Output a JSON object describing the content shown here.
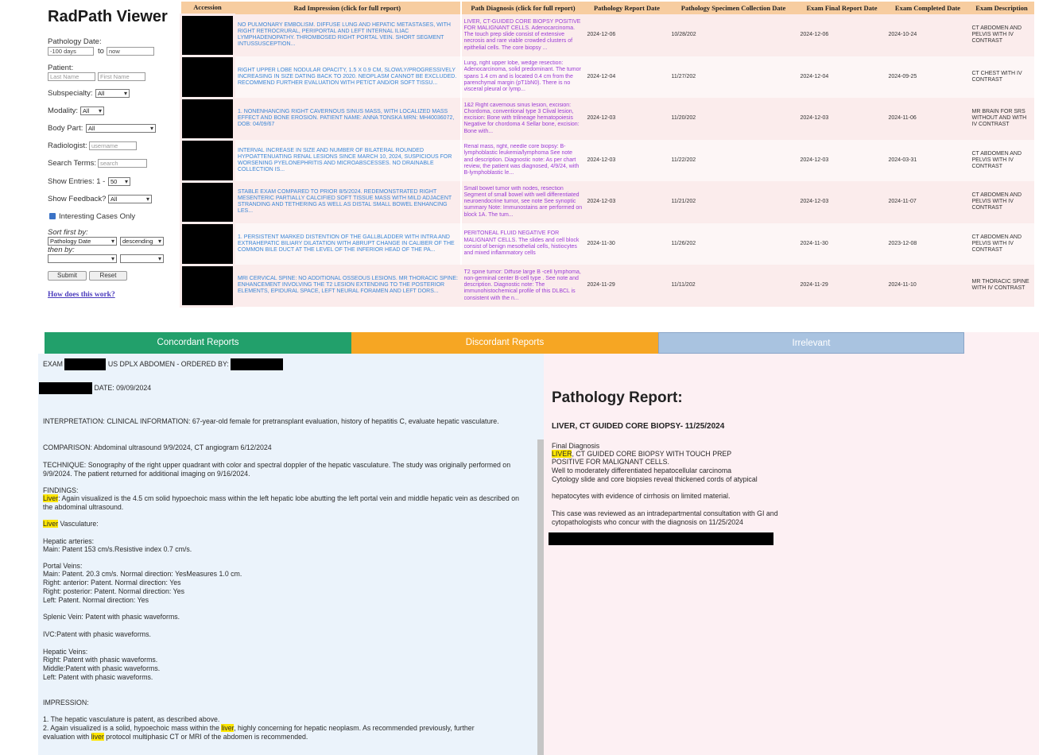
{
  "app": {
    "title": "RadPath Viewer"
  },
  "filters": {
    "pathology_date_label": "Pathology Date:",
    "date_from": "-100 days",
    "date_to_label": "to",
    "date_to": "now",
    "patient_label": "Patient:",
    "last_name_placeholder": "Last Name",
    "first_name_placeholder": "First Name",
    "subspecialty_label": "Subspecialty:",
    "subspecialty_value": "All",
    "modality_label": "Modality:",
    "modality_value": "All",
    "body_part_label": "Body Part:",
    "body_part_value": "All",
    "radiologist_label": "Radiologist:",
    "radiologist_placeholder": "username",
    "search_label": "Search Terms:",
    "search_placeholder": "search",
    "show_entries_label": "Show Entries: 1 -",
    "show_entries_value": "50",
    "show_feedback_label": "Show Feedback?",
    "show_feedback_value": "All",
    "interesting_label": "Interesting Cases Only",
    "sort_first_label": "Sort first by:",
    "sort_first_value": "Pathology Date",
    "sort_order_value": "descending",
    "then_by_label": "then by:",
    "submit_label": "Submit",
    "reset_label": "Reset",
    "how_link": "How does this work?"
  },
  "table": {
    "headers": [
      "Accession",
      "Rad Impression (click for full report)",
      "Path Diagnosis (click for full report)",
      "Pathology Report Date",
      "Pathology Specimen Collection Date",
      "Exam Final Report Date",
      "Exam Completed Date",
      "Exam Description"
    ],
    "rows": [
      {
        "rad": "NO PULMONARY EMBOLISM. DIFFUSE LUNG AND HEPATIC METASTASES, WITH RIGHT RETROCRURAL, PERIPORTAL AND LEFT INTERNAL ILIAC LYMPHADENOPATHY. THROMBOSED RIGHT PORTAL VEIN. SHORT SEGMENT INTUSSUSCEPTION...",
        "path": "LIVER, CT-GUIDED CORE BIOPSY POSITIVE FOR MALIGNANT CELLS. Adenocarcinoma. The touch prep slide consist of extensive necrosis and rare viable crowded clusters of epithelial cells. The core biopsy ...",
        "prd": "2024-12-06",
        "psc": "10/28/202",
        "efr": "2024-12-06",
        "ecd": "2024-10-24",
        "desc": "CT ABDOMEN AND PELVIS WITH IV CONTRAST"
      },
      {
        "rad": "RIGHT UPPER LOBE NODULAR OPACITY, 1.5 X 0.9 CM, SLOWLY/PROGRESSIVELY INCREASING IN SIZE DATING BACK TO 2020. NEOPLASM CANNOT BE EXCLUDED. RECOMMEND FURTHER EVALUATION WITH PET/CT AND/OR SOFT TISSU...",
        "path": "Lung, right upper lobe, wedge resection: Adenocarcinoma, solid predominant. The tumor spans 1.4 cm and is located 0.4 cm from the parenchymal margin (pT1bN0). There is no visceral pleural or lymp...",
        "prd": "2024-12-04",
        "psc": "11/27/202",
        "efr": "2024-12-04",
        "ecd": "2024-09-25",
        "desc": "CT CHEST WITH IV CONTRAST"
      },
      {
        "rad": "1. NONENHANCING RIGHT CAVERNOUS SINUS MASS, WITH LOCALIZED MASS EFFECT AND BONE EROSION. PATIENT NAME: ANNA TONSKA MRN: MH40036072, DOB: 04/09/67",
        "path": "1&2 Right cavernous sinus lesion, excision: Chordoma, conventional type 3 Clival lesion, excision: Bone with trilineage hematopoiesis Negative for chordoma 4 Sellar bone, excision: Bone with...",
        "prd": "2024-12-03",
        "psc": "11/20/202",
        "efr": "2024-12-03",
        "ecd": "2024-11-06",
        "desc": "MR BRAIN FOR SRS WITHOUT AND WITH IV CONTRAST"
      },
      {
        "rad": "INTERVAL INCREASE IN SIZE AND NUMBER OF BILATERAL ROUNDED HYPOATTENUATING RENAL LESIONS SINCE MARCH 10, 2024, SUSPICIOUS FOR WORSENING PYELONEPHRITIS AND MICROABSCESSES. NO DRAINABLE COLLECTION IS...",
        "path": "Renal mass, right, needle core biopsy: B-lymphoblastic leukemia/lymphoma See note and description. Diagnostic note: As per chart review, the patient was diagnosed, 4/9/24, with B-lymphoblastic le...",
        "prd": "2024-12-03",
        "psc": "11/22/202",
        "efr": "2024-12-03",
        "ecd": "2024-03-31",
        "desc": "CT ABDOMEN AND PELVIS WITH IV CONTRAST"
      },
      {
        "rad": "STABLE EXAM COMPARED TO PRIOR 8/5/2024. REDEMONSTRATED RIGHT MESENTERIC PARTIALLY CALCIFIED SOFT TISSUE MASS WITH MILD ADJACENT STRANDING AND TETHERING AS WELL AS DISTAL SMALL BOWEL ENHANCING LES...",
        "path": "Small bowel tumor with nodes, resection Segment of small bowel with well differentiated neuroendocrine tumor, see note See synoptic summary Note: Immunostains are performed on block 1A. The tum...",
        "prd": "2024-12-03",
        "psc": "11/21/202",
        "efr": "2024-12-03",
        "ecd": "2024-11-07",
        "desc": "CT ABDOMEN AND PELVIS WITH IV CONTRAST"
      },
      {
        "rad": "1. PERSISTENT MARKED DISTENTION OF THE GALLBLADDER WITH INTRA AND EXTRAHEPATIC BILIARY DILATATION WITH ABRUPT CHANGE IN CALIBER OF THE COMMON BILE DUCT AT THE LEVEL OF THE INFERIOR HEAD OF THE PA...",
        "path": "PERITONEAL FLUID NEGATIVE FOR MALIGNANT CELLS. The slides and cell block consist of benign mesothelial cells, histiocytes and mixed inflammatory cells",
        "prd": "2024-11-30",
        "psc": "11/26/202",
        "efr": "2024-11-30",
        "ecd": "2023-12-08",
        "desc": "CT ABDOMEN AND PELVIS WITH IV CONTRAST"
      },
      {
        "rad": "MRI CERVICAL SPINE: NO ADDITIONAL OSSEOUS LESIONS. MR THORACIC SPINE: ENHANCEMENT INVOLVING THE T2 LESION EXTENDING TO THE POSTERIOR ELEMENTS, EPIDURAL SPACE, LEFT NEURAL FORAMEN AND LEFT DORS...",
        "path": "T2 spine tumor: Diffuse large B -cell lymphoma, non-germinal center B-cell type . See note and description. Diagnostic note: The immunohistochemical profile of this DLBCL is consistent with the n...",
        "prd": "2024-11-29",
        "psc": "11/11/202",
        "efr": "2024-11-29",
        "ecd": "2024-11-10",
        "desc": "MR THORACIC SPINE WITH IV CONTRAST"
      }
    ]
  },
  "tabs": {
    "concordant": "Concordant Reports",
    "discordant": "Discordant Reports",
    "irrelevant": "Irrelevant"
  },
  "colors": {
    "concordant": "#22a06b",
    "discordant": "#f6a623",
    "irrelevant": "#a9c3e0",
    "header": "#f7cda0",
    "rad_text": "#3a86d6",
    "path_text": "#9b3bd6",
    "highlight": "#ffe600"
  },
  "radreport": {
    "exam_label": "EXAM",
    "exam_title": "US DPLX ABDOMEN - ORDERED BY:",
    "date": "DATE: 09/09/2024",
    "interpretation": "INTERPRETATION: CLINICAL INFORMATION: 67-year-old female for pretransplant evaluation, history of hepatitis C, evaluate hepatic vasculature.",
    "comparison": "COMPARISON: Abdominal ultrasound 9/9/2024, CT angiogram 6/12/2024",
    "technique": "TECHNIQUE: Sonography of the right upper quadrant with color and spectral doppler of the hepatic vasculature. The study was originally performed on 9/9/2024. The patient returned for additional imaging on 9/16/2024.",
    "findings_label": "FINDINGS:",
    "liver_word": "Liver",
    "findings_text": ": Again visualized is the 4.5 cm solid hypoechoic mass within the left hepatic lobe abutting the left portal vein and middle hepatic vein as described on the abdominal ultrasound.",
    "vasculature": " Vasculature:",
    "hepatic_arteries": "Hepatic arteries:",
    "main_artery": "Main: Patent 153 cm/s.Resistive index 0.7 cm/s.",
    "portal_veins": "Portal Veins:",
    "pv_main": "Main: Patent. 20.3 cm/s. Normal direction: YesMeasures 1.0 cm.",
    "pv_right_anterior": "Right: anterior: Patent. Normal direction: Yes",
    "pv_right_posterior": "Right: posterior: Patent. Normal direction: Yes",
    "pv_left": "Left: Patent. Normal direction: Yes",
    "splenic": "Splenic Vein: Patent with phasic waveforms.",
    "ivc": "IVC:Patent with phasic waveforms.",
    "hepatic_veins": "Hepatic Veins:",
    "hv_right": "Right: Patent with phasic waveforms.",
    "hv_middle": "Middle:Patent with phasic waveforms.",
    "hv_left": "Left: Patent with phasic waveforms.",
    "impression_label": "IMPRESSION:",
    "imp1": "1. The hepatic vasculature is patent, as described above.",
    "imp2a": "2. Again visualized is a solid, hypoechoic mass within the",
    "imp2_liver": "liver",
    "imp2b": ", highly concerning for hepatic neoplasm. As recommended previously, further",
    "imp3a": "evaluation with",
    "imp3_liver": "liver",
    "imp3b": "protocol multiphasic CT or MRI of the abdomen is recommended."
  },
  "pathreport": {
    "title": "Pathology Report:",
    "subtitle": "LIVER, CT GUIDED CORE BIOPSY- 11/25/2024",
    "final_dx": "Final Diagnosis",
    "liver_word": "LIVER",
    "line1": ", CT GUIDED CORE BIOPSY WITH TOUCH PREP",
    "line2": "POSITIVE FOR MALIGNANT CELLS.",
    "line3": "Well to moderately differentiated hepatocellular carcinoma",
    "line4": "Cytology slide and core biopsies reveal thickened cords of atypical",
    "line5": "hepatocytes with evidence of cirrhosis on limited material.",
    "line6": "This case was reviewed as an intradepartmental consultation with GI and",
    "line7": "cytopathologists who concur with the diagnosis on 11/25/2024"
  }
}
